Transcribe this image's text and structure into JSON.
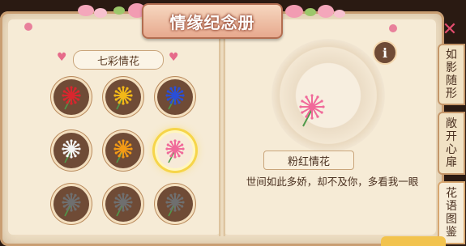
{
  "window_title": "情缘纪念册",
  "left_page": {
    "section_title": "七彩情花",
    "flowers": [
      {
        "color": "#d9262e",
        "selected": false
      },
      {
        "color": "#f2b818",
        "selected": false
      },
      {
        "color": "#2a4fd6",
        "selected": false
      },
      {
        "color": "#f2f2f2",
        "selected": false
      },
      {
        "color": "#f29a16",
        "selected": false
      },
      {
        "color": "#f06a9a",
        "selected": true
      },
      {
        "color": "#6f6f6f",
        "selected": false
      },
      {
        "color": "#6f6f6f",
        "selected": false
      },
      {
        "color": "#6f6f6f",
        "selected": false
      }
    ]
  },
  "right_page": {
    "info_label": "i",
    "flower_name": "粉红情花",
    "flower_color": "#f06a9a",
    "description": "世间如此多娇，却不及你，多看我一眼"
  },
  "side_tabs": [
    {
      "label": "如影随形",
      "chars": [
        "如",
        "影",
        "随",
        "形"
      ]
    },
    {
      "label": "敞开心扉",
      "chars": [
        "敞",
        "开",
        "心",
        "扉"
      ]
    },
    {
      "label": "花语图鉴",
      "chars": [
        "花",
        "语",
        "图",
        "鉴"
      ],
      "active": true
    }
  ],
  "close_label": "✕"
}
